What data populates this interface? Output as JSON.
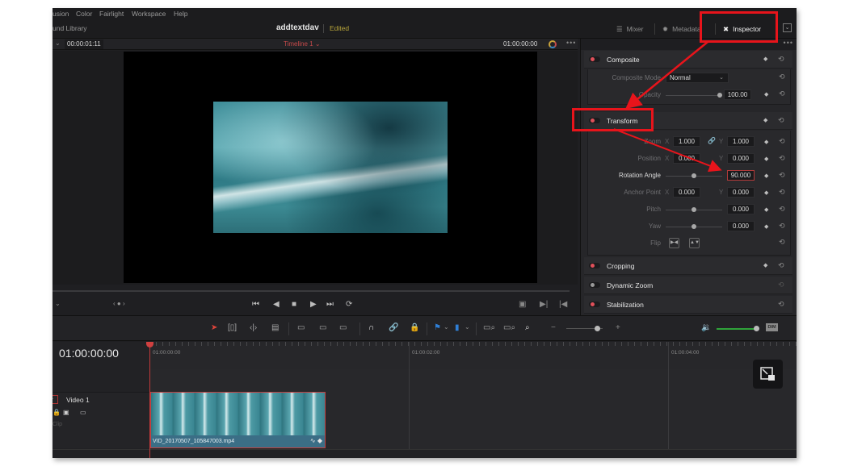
{
  "menu": [
    "usion",
    "Color",
    "Fairlight",
    "Workspace",
    "Help"
  ],
  "titlebar": {
    "library": "und Library",
    "project": "addtextdav",
    "status": "Edited",
    "tabs": [
      {
        "label": "Mixer",
        "icon": "mixer-icon",
        "active": false
      },
      {
        "label": "Metadata",
        "icon": "metadata-icon",
        "active": false
      },
      {
        "label": "Inspector",
        "icon": "inspector-icon",
        "active": true
      }
    ]
  },
  "viewer": {
    "source_timecode": "00:00:01:11",
    "timeline_name": "Timeline 1",
    "timecode": "01:00:00:00"
  },
  "inspector": {
    "sections": {
      "composite": {
        "title": "Composite",
        "enabled": true
      },
      "transform": {
        "title": "Transform",
        "enabled": true
      },
      "cropping": {
        "title": "Cropping",
        "enabled": true
      },
      "dynamic_zoom": {
        "title": "Dynamic Zoom",
        "enabled": false
      },
      "stabilization": {
        "title": "Stabilization",
        "enabled": true
      }
    },
    "composite": {
      "mode_label": "Composite Mode",
      "mode_value": "Normal",
      "opacity_label": "Opacity",
      "opacity_value": "100.00",
      "opacity_fraction": 1.0
    },
    "transform": {
      "zoom_label": "Zoom",
      "zoom_x": "1.000",
      "zoom_y": "1.000",
      "position_label": "Position",
      "position_x": "0.000",
      "position_y": "0.000",
      "rotation_label": "Rotation Angle",
      "rotation_value": "90.000",
      "anchor_label": "Anchor Point",
      "anchor_x": "0.000",
      "anchor_y": "0.000",
      "pitch_label": "Pitch",
      "pitch_value": "0.000",
      "yaw_label": "Yaw",
      "yaw_value": "0.000",
      "flip_label": "Flip",
      "axis_x": "X",
      "axis_y": "Y"
    }
  },
  "transport": {
    "controls": [
      "skip-to-start",
      "step-back",
      "stop",
      "play",
      "skip-to-end",
      "loop"
    ]
  },
  "timeline": {
    "timecode": "01:00:00:00",
    "ruler_labels": [
      "01:00:00:00",
      "01:00:02:00",
      "01:00:04:00"
    ],
    "track_name": "Video 1",
    "track_number": "1",
    "clip_label": "Clip",
    "clip_name": "VID_20170507_105847003.mp4",
    "dim_label": "DIM",
    "zoom_fraction": 0.85,
    "volume_fraction": 1.0
  },
  "colors": {
    "accent_red": "#e8141b",
    "timeline_name": "#c54a4a",
    "edited": "#b7a43a",
    "volume": "#2fa33a",
    "clip": "#3b6e86"
  }
}
